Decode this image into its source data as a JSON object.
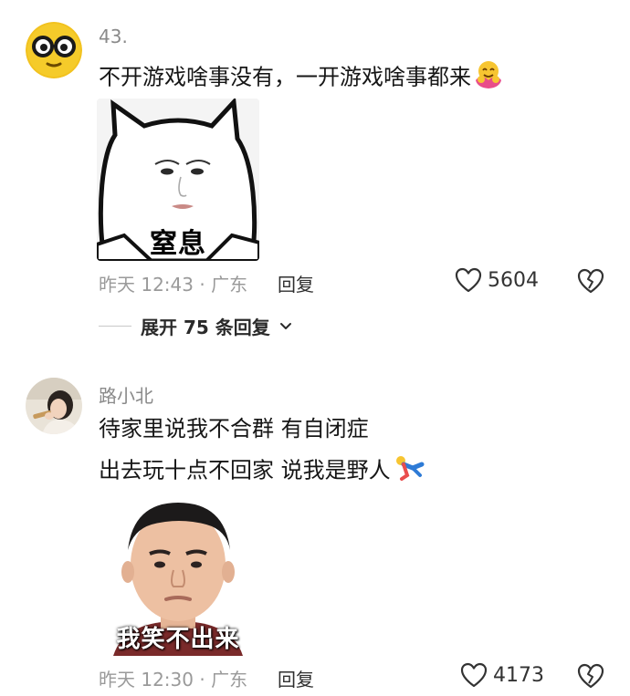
{
  "comments": [
    {
      "username": "43.",
      "avatar_icon": "emoji-glasses-face-icon",
      "text_lines": [
        "不开游戏啥事没有，一开游戏啥事都来"
      ],
      "trailing_emoji": "hug-emoji-icon",
      "meme_caption": "窒息",
      "time_location": "昨天 12:43 · 广东",
      "reply_label": "回复",
      "likes": "5604",
      "expand_label": "展开 75 条回复"
    },
    {
      "username": "路小北",
      "avatar_icon": "user-photo-avatar",
      "text_lines": [
        "待家里说我不合群 有自闭症",
        "出去玩十点不回家 说我是野人"
      ],
      "trailing_emoji": "running-man-emoji-icon",
      "meme_caption": "我笑不出来",
      "time_location": "昨天 12:30 · 广东",
      "reply_label": "回复",
      "likes": "4173"
    }
  ],
  "colors": {
    "text_primary": "#161616",
    "text_meta": "#9a9a9a",
    "username": "#8a8a8a",
    "avatar_yellow": "#f2c21f"
  }
}
